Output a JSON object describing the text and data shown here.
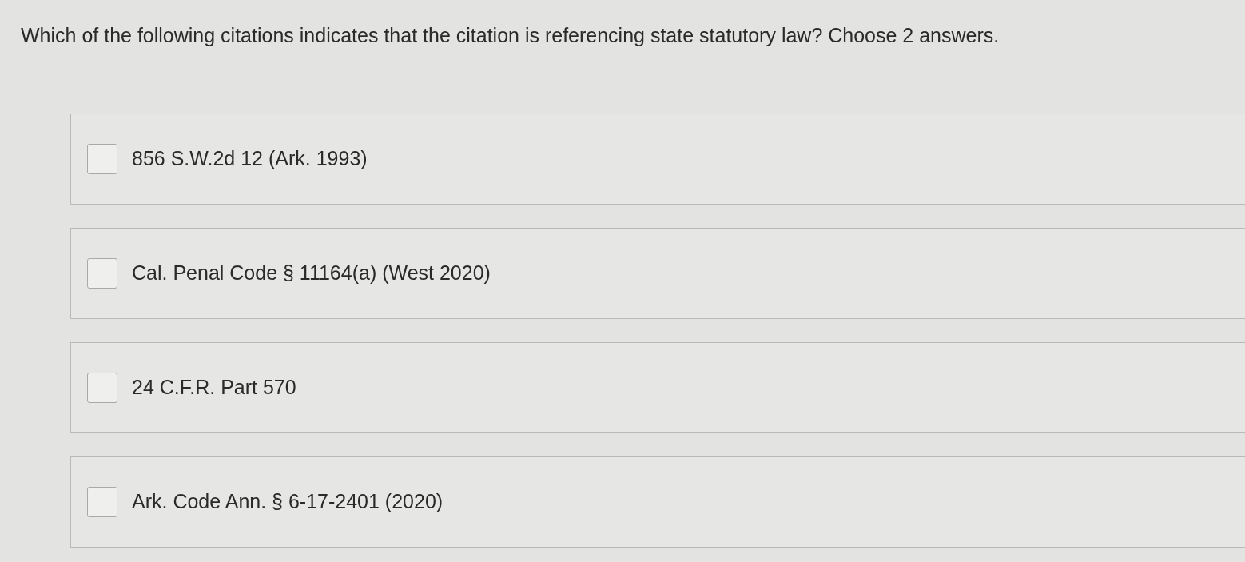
{
  "question": "Which of the following citations indicates that the citation is referencing state statutory law? Choose 2 answers.",
  "options": [
    {
      "label": "856 S.W.2d 12 (Ark. 1993)",
      "checked": false
    },
    {
      "label": "Cal. Penal Code § 11164(a) (West 2020)",
      "checked": false
    },
    {
      "label": "24 C.F.R. Part 570",
      "checked": false
    },
    {
      "label": "Ark. Code Ann. § 6-17-2401 (2020)",
      "checked": false
    }
  ]
}
